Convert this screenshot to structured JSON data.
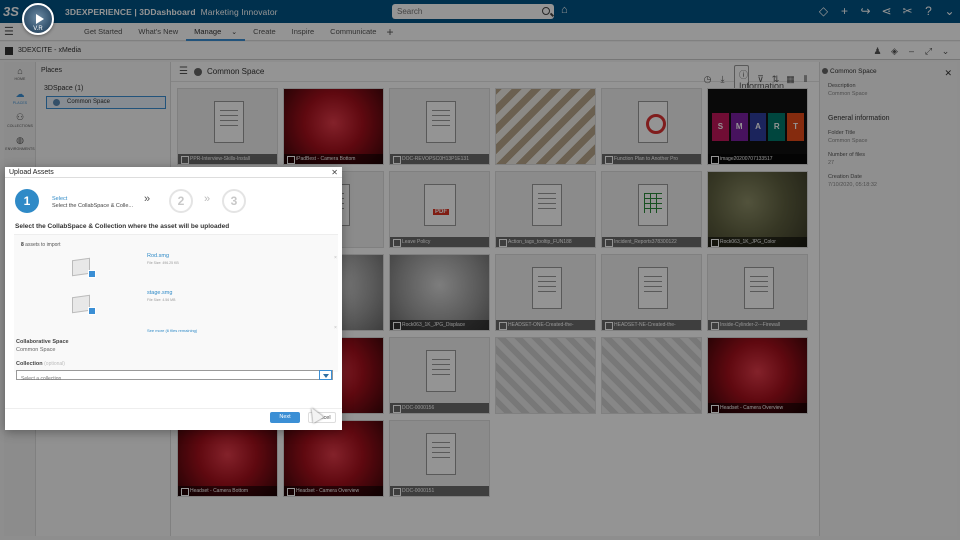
{
  "topbar": {
    "brand_prefix": "3DEXPERIENCE | 3DDashboard",
    "brand_app": "Marketing Innovator",
    "search_placeholder": "Search"
  },
  "tabs": [
    {
      "label": "Get Started"
    },
    {
      "label": "What's New"
    },
    {
      "label": "Manage"
    },
    {
      "label": "Create"
    },
    {
      "label": "Inspire"
    },
    {
      "label": "Communicate"
    }
  ],
  "app": {
    "title": "3DEXCITE - xMedia"
  },
  "leftnav": {
    "home": "HOME",
    "places": "PLACES",
    "collections": "COLLECTIONS",
    "environments": "ENVIRONMENTS"
  },
  "places": {
    "title": "Places",
    "root": "3DSpace (1)",
    "node": "Common Space"
  },
  "content": {
    "title": "Common Space",
    "info_button": "Information"
  },
  "tiles": [
    {
      "caption": "PPR-Interview-Skills-Install"
    },
    {
      "caption": "iPadBest - Camera Bottom"
    },
    {
      "caption": "DOC-REVOPSC0H13P1E131"
    },
    {
      "caption": ""
    },
    {
      "caption": "Function Plan to Another Pro"
    },
    {
      "caption": "image20200707133517"
    },
    {
      "caption": "Leave Policy"
    },
    {
      "caption": "Action_tags_tooltip_FUN188"
    },
    {
      "caption": "Incident_Reports378300122"
    },
    {
      "caption": "Rock063_1K_JPG_Color"
    },
    {
      "caption": "Rock063_1K_JPG_Displace"
    },
    {
      "caption": "HEADSET-ONE-Created-the-"
    },
    {
      "caption": "HEADSET-NE-Created-the-"
    },
    {
      "caption": "Inside-Cylinder-2---Firewall"
    },
    {
      "caption": "DOC-0000156"
    },
    {
      "caption": "Headset - Camera Overview"
    },
    {
      "caption": "Headset - Camera Bottom"
    },
    {
      "caption": "Headset - Camera Overview"
    },
    {
      "caption": "DOC-0000151"
    }
  ],
  "info_panel": {
    "title": "Common Space",
    "description_label": "Description",
    "description_value": "Common Space",
    "section": "General information",
    "folder_title_label": "Folder Title",
    "folder_title_value": "Common Space",
    "files_label": "Number of files",
    "files_value": "27",
    "date_label": "Creation Date",
    "date_value": "7/10/2020, 05:18:32"
  },
  "dialog": {
    "title": "Upload Assets",
    "step1_number": "1",
    "step1_title": "Select",
    "step1_desc": "Select the CollabSpace & Colle...",
    "step2_number": "2",
    "step3_number": "3",
    "subtitle": "Select the CollabSpace & Collection where the asset will be uploaded",
    "asset_count_number": "8",
    "asset_count_text": "assets to import",
    "assets": [
      {
        "name": "Rod.smg",
        "size": "File Size: 496.25 KB"
      },
      {
        "name": "stage.smg",
        "size": "File Size: 4.56 MB"
      }
    ],
    "see_more": "See more (6 files remaining)",
    "collab_label": "Collaborative Space",
    "collab_value": "Common Space",
    "collection_label": "Collection",
    "collection_optional": "(optional)",
    "collection_placeholder": "Select a collection",
    "next_label": "Next",
    "cancel_label": "Cancel"
  }
}
